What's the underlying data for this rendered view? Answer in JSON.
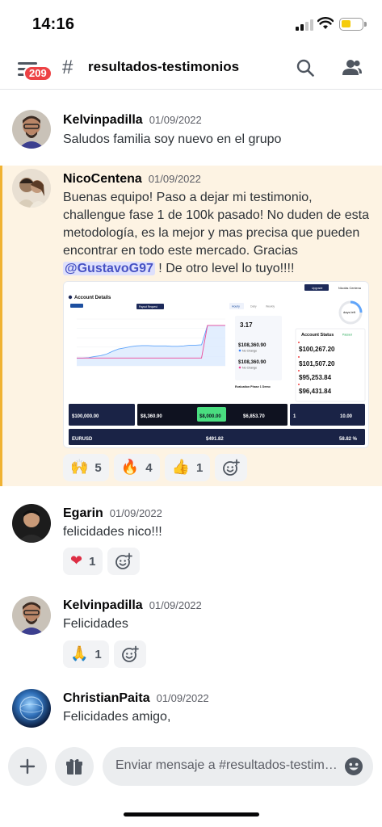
{
  "status_bar": {
    "time": "14:16",
    "battery_level": 0.35
  },
  "header": {
    "menu_icon": "menu-icon",
    "unread_badge": "209",
    "channel_icon": "hashtag-icon",
    "channel_name": "resultados-testimonios",
    "search_icon": "search-icon",
    "members_icon": "members-icon"
  },
  "messages": [
    {
      "author": "Kelvinpadilla",
      "timestamp": "01/09/2022",
      "text": "Saludos familia soy nuevo en el grupo"
    },
    {
      "author": "NicoCentena",
      "timestamp": "01/09/2022",
      "text_before": "Buenas equipo! Paso a dejar mi testimonio, challengue fase 1 de 100k pasado! No duden de esta metodología, es la mejor y mas precisa que pueden encontrar en todo este mercado. Gracias ",
      "mention": "@GustavoG97",
      "text_after": " ! De otro level lo tuyo!!!!",
      "highlighted": true,
      "attachment": {
        "title": "Account Details",
        "upgrade_label": "Upgrade",
        "user_label": "Nicolás Centena",
        "payout_label": "Payout Request",
        "tabs": [
          "Hourly",
          "Daily",
          "Weekly"
        ],
        "win_ratio": "3.17",
        "equity": "$108,360.90",
        "balance": "$108,360.90",
        "no_change": "No Change",
        "phase_label": "Evaluation Phase 1 Demo",
        "account_status_title": "Account Status",
        "status_badge": "Passed",
        "status_values": [
          "$100,267.20",
          "$101,507.20",
          "$95,253.84",
          "$96,431.84"
        ],
        "days_left": "days left",
        "starting_balance": "$100,000.00",
        "current_equity": "$8,360.90",
        "profit_target": "$8,000.00",
        "max_profit": "$6,853.70",
        "trades": "1",
        "lots": "10.00",
        "instrument": "EURUSD",
        "avg_profit": "$491.82",
        "win_rate": "58.82 %",
        "chart_series": [
          100000,
          100000,
          100100,
          100400,
          100600,
          101000,
          101700,
          102300,
          102600,
          102900,
          103100,
          103200,
          103200,
          103100,
          103100,
          103100,
          103000,
          103000,
          103100,
          103300,
          103300,
          103400,
          108360,
          108360,
          108360,
          108360
        ],
        "chart_ylim": [
          98000,
          110000
        ]
      },
      "reactions": [
        {
          "emoji": "🙌",
          "count": "5"
        },
        {
          "emoji": "🔥",
          "count": "4"
        },
        {
          "emoji": "👍",
          "count": "1"
        }
      ]
    },
    {
      "author": "Egarin",
      "timestamp": "01/09/2022",
      "text": "felicidades nico!!!",
      "reactions": [
        {
          "emoji": "❤",
          "count": "1"
        }
      ]
    },
    {
      "author": "Kelvinpadilla",
      "timestamp": "01/09/2022",
      "text": "Felicidades",
      "reactions": [
        {
          "emoji": "🙏",
          "count": "1"
        }
      ]
    },
    {
      "author": "ChristianPaita",
      "timestamp": "01/09/2022",
      "text": "Felicidades amigo,"
    }
  ],
  "composer": {
    "add_icon": "plus-icon",
    "gift_icon": "gift-icon",
    "placeholder": "Enviar mensaje a #resultados-testimonios",
    "emoji_icon": "emoji-icon"
  },
  "colors": {
    "accent": "#5865f2",
    "mention_bg": "#dee0fc",
    "highlight_bg": "#fdf3e3",
    "highlight_bar": "#f0b232",
    "badge": "#ed4245"
  }
}
